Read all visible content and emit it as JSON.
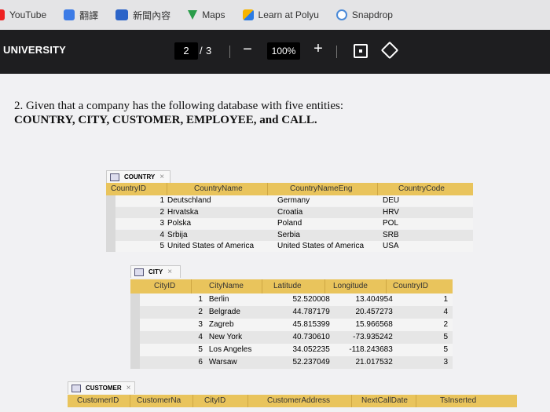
{
  "bookmarks": [
    {
      "label": "YouTube",
      "icon": "youtube-icon"
    },
    {
      "label": "翻譯",
      "icon": "translate-icon"
    },
    {
      "label": "新聞內容",
      "icon": "news-icon"
    },
    {
      "label": "Maps",
      "icon": "maps-icon"
    },
    {
      "label": "Learn at Polyu",
      "icon": "learn-icon"
    },
    {
      "label": "Snapdrop",
      "icon": "snapdrop-icon"
    }
  ],
  "toolbar": {
    "title": "UNIVERSITY",
    "page_current": "2",
    "page_sep": "/",
    "page_total": "3",
    "zoom_out": "−",
    "zoom": "100%",
    "zoom_in": "+"
  },
  "question": {
    "line1": "2. Given that a company has the following database with five entities:",
    "line2": "COUNTRY, CITY, CUSTOMER, EMPLOYEE, and CALL."
  },
  "country_table": {
    "tab": "COUNTRY",
    "headers": [
      "CountryID",
      "CountryName",
      "CountryNameEng",
      "CountryCode"
    ],
    "rows": [
      [
        "1",
        "Deutschland",
        "Germany",
        "DEU"
      ],
      [
        "2",
        "Hrvatska",
        "Croatia",
        "HRV"
      ],
      [
        "3",
        "Polska",
        "Poland",
        "POL"
      ],
      [
        "4",
        "Srbija",
        "Serbia",
        "SRB"
      ],
      [
        "5",
        "United States of America",
        "United States of America",
        "USA"
      ]
    ]
  },
  "city_table": {
    "tab": "CITY",
    "headers": [
      "CityID",
      "CityName",
      "Latitude",
      "Longitude",
      "CountryID"
    ],
    "rows": [
      [
        "1",
        "Berlin",
        "52.520008",
        "13.404954",
        "1"
      ],
      [
        "2",
        "Belgrade",
        "44.787179",
        "20.457273",
        "4"
      ],
      [
        "3",
        "Zagreb",
        "45.815399",
        "15.966568",
        "2"
      ],
      [
        "4",
        "New York",
        "40.730610",
        "-73.935242",
        "5"
      ],
      [
        "5",
        "Los Angeles",
        "34.052235",
        "-118.243683",
        "5"
      ],
      [
        "6",
        "Warsaw",
        "52.237049",
        "21.017532",
        "3"
      ]
    ]
  },
  "customer_table": {
    "tab": "CUSTOMER",
    "headers": [
      "CustomerID",
      "CustomerNa",
      "CityID",
      "CustomerAddress",
      "NextCallDate",
      "TsInserted"
    ]
  },
  "tab_close": "×"
}
